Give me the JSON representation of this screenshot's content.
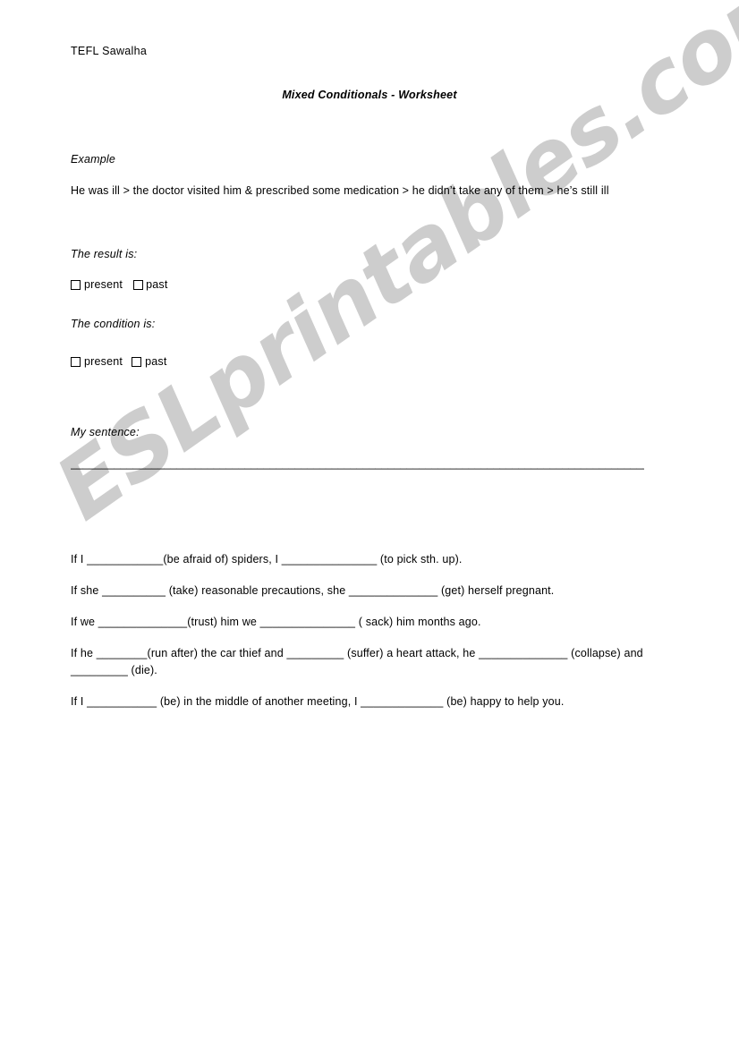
{
  "document": {
    "author": "TEFL Sawalha",
    "title": "Mixed Conditionals - Worksheet"
  },
  "example": {
    "label": "Example",
    "sentence": "He was ill > the doctor visited him & prescribed some medication > he didn’t take any of them > he’s still ill"
  },
  "result_section": {
    "label": "The result is:",
    "options": [
      "present",
      "past"
    ]
  },
  "condition_section": {
    "label": "The condition is:",
    "options": [
      "present",
      "past"
    ]
  },
  "my_sentence": {
    "label": "My sentence:",
    "answer_line": "________________________________________________________________________________________________"
  },
  "exercises": [
    "If I ____________(be afraid of)  spiders, I _______________ (to pick sth. up).",
    "If she __________ (take) reasonable precautions, she ______________ (get)  herself pregnant.",
    "If we ______________(trust) him we _______________ ( sack) him months ago.",
    "If he ________(run after)  the car thief and _________ (suffer) a heart attack, he ______________ (collapse) and _________ (die).",
    "If I ___________ (be) in the middle of another meeting, I _____________ (be) happy to help you."
  ],
  "watermark": {
    "text": "ESLprintables.com",
    "color": "#cdcdcd"
  }
}
